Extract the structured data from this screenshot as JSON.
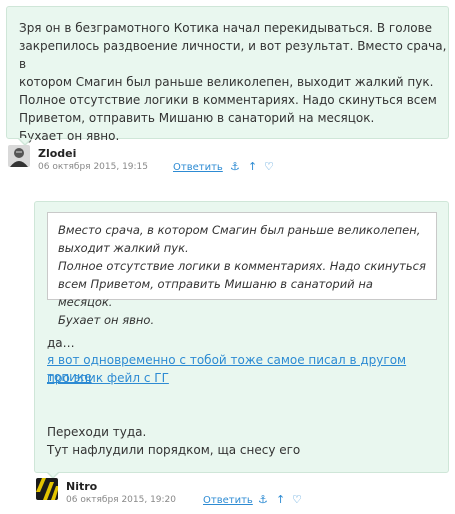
{
  "comment1": {
    "text": "Зря он в безграмотного Котика начал перекидываться. В голове\nзакрепилось раздвоение личности, и вот результат. Вместо срача, в\nкотором Смагин был раньше великолепен, выходит жалкий пук.\nПолное отсутствие логики в комментариях. Надо скинуться всем\nПриветом, отправить Мишаню в санаторий на месяцок.\nБухает он явно.",
    "author": "Zlodei",
    "date": "06 октября 2015, 19:15",
    "reply_label": "Ответить",
    "anchor_icon": "⚓",
    "up_icon": "↑",
    "heart_icon": "♡"
  },
  "comment2": {
    "quote": "Вместо срача, в котором Смагин был раньше великолепен,\nвыходит жалкий пук.\nПолное отсутствие логики в комментариях. Надо скинуться\nвсем Приветом, отправить Мишаню в санаторий на месяцок.\nБухает он явно.",
    "line_da": "да…",
    "link_text_1": "я вот одновременно с тобой тоже самое писал в другом топике",
    "link_text_2": "про эпик фейл с ГГ",
    "line_go": "Переходи туда.",
    "line_order": "Тут нафлудили порядком, ща снесу его",
    "author": "Nitro",
    "date": "06 октября 2015, 19:20",
    "reply_label": "Ответить",
    "anchor_icon": "⚓",
    "up_icon": "↑",
    "heart_icon": "♡"
  },
  "colors": {
    "bubble_bg": "#e9f7ef",
    "link": "#2d8bd3"
  }
}
